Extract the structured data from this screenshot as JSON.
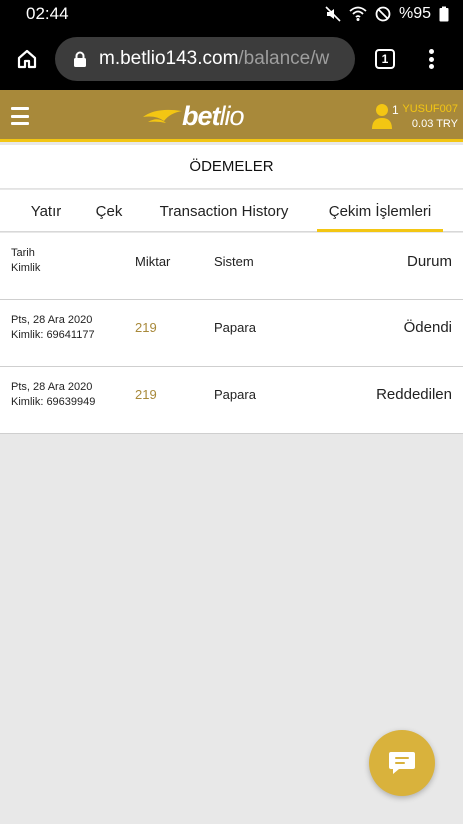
{
  "status_bar": {
    "time": "02:44",
    "battery": "%95"
  },
  "browser": {
    "url_host": "m.betlio143.com",
    "url_path": "/balance/w",
    "tabs_count": "1"
  },
  "header": {
    "logo_text_bold": "bet",
    "logo_text_light": "lio",
    "user_count": "1",
    "username": "YUSUF007",
    "balance": "0.03 TRY",
    "accent_color": "#f3c613",
    "header_color": "#a8893a"
  },
  "page": {
    "title": "ÖDEMELER"
  },
  "tabs": [
    {
      "label": "Yatır"
    },
    {
      "label": "Çek"
    },
    {
      "label": "Transaction History"
    },
    {
      "label": "Çekim İşlemleri"
    }
  ],
  "table": {
    "headers": {
      "date": "Tarih",
      "id": "Kimlik",
      "amount": "Miktar",
      "system": "Sistem",
      "status": "Durum"
    },
    "rows": [
      {
        "date": "Pts, 28 Ara 2020",
        "id": "Kimlik: 69641177",
        "amount": "219",
        "system": "Papara",
        "status": "Ödendi"
      },
      {
        "date": "Pts, 28 Ara 2020",
        "id": "Kimlik: 69639949",
        "amount": "219",
        "system": "Papara",
        "status": "Reddedilen"
      }
    ]
  },
  "icons": {
    "home": "home-icon",
    "lock": "lock-icon",
    "menu": "more-vert-icon",
    "hamburger": "hamburger-icon",
    "user": "user-icon",
    "chat": "chat-icon"
  }
}
